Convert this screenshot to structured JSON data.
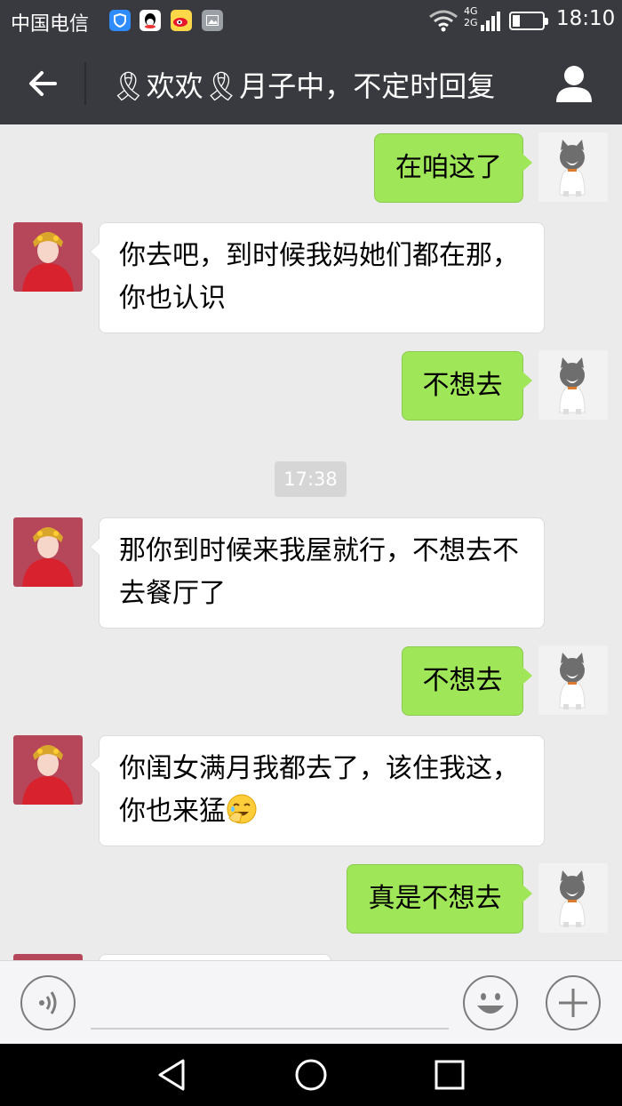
{
  "status_bar": {
    "carrier": "中国电信",
    "network_top": "4G",
    "network_bottom": "2G",
    "time": "18:10",
    "battery_level": 0.25
  },
  "header": {
    "title": "🎗欢欢🎗月子中，不定时回复",
    "back_icon": "arrow-left-icon",
    "profile_icon": "person-icon"
  },
  "messages": [
    {
      "from": "me",
      "text": "在咱这了"
    },
    {
      "from": "other",
      "lines": [
        "你去吧，到时候我妈她们都在那，",
        "你也认识"
      ]
    },
    {
      "from": "me",
      "text": "不想去"
    },
    {
      "from": "system",
      "text": "17:38"
    },
    {
      "from": "other",
      "lines": [
        "那你到时候来我屋就行，不想去不",
        "去餐厅了"
      ]
    },
    {
      "from": "me",
      "text": "不想去"
    },
    {
      "from": "other",
      "lines": [
        "你闺女满月我都去了，该住我这，",
        "你也来猛"
      ],
      "emoji": "facepalm-laughing-emoji"
    },
    {
      "from": "me",
      "text": "真是不想去"
    }
  ],
  "input_bar": {
    "voice_icon": "voice-icon",
    "emoji_icon": "smiley-icon",
    "more_icon": "plus-icon"
  },
  "nav_bar": {
    "back_icon": "triangle-back-icon",
    "home_icon": "circle-home-icon",
    "recents_icon": "square-recents-icon"
  },
  "colors": {
    "bar": "#393a3f",
    "chat_bg": "#ebebeb",
    "outgoing_bubble": "#9fe658",
    "incoming_bubble": "#ffffff"
  }
}
